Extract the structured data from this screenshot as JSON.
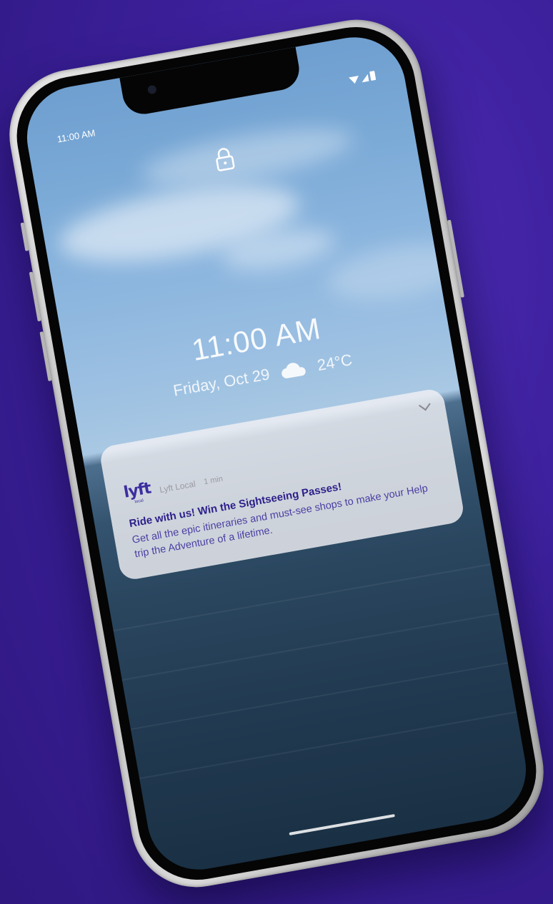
{
  "status_bar": {
    "time": "11:00 AM"
  },
  "lock_screen": {
    "lock_icon": "lock-icon",
    "clock": "11:00 AM",
    "date": "Friday, Oct 29",
    "weather_icon": "cloud-icon",
    "temperature": "24°C"
  },
  "notification": {
    "app_logo_text": "lyft",
    "app_logo_subtext": "local",
    "app_name": "Lyft Local",
    "time_ago": "1 min",
    "title": "Ride with us! Win the Sightseeing Passes!",
    "body": "Get all the epic itineraries and must-see shops to make your Help trip the Adventure of a lifetime.",
    "expand_icon": "chevron-down-icon"
  },
  "colors": {
    "background": "#3b1f9a",
    "notification_title": "#2d1f8a",
    "notification_text": "#4a3fa3",
    "logo": "#3d2ea0"
  }
}
